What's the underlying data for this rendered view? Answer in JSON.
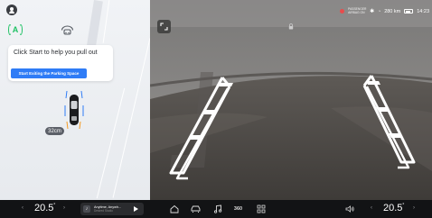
{
  "status_bar": {
    "airbag_text": "PASSENGER AIRBAG ON",
    "range": "280 km",
    "time": "14:23"
  },
  "parking_panel": {
    "hint_text": "Click Start to help you pull out",
    "start_button_label": "Start Exiting the Parking Space",
    "distance": "32cm"
  },
  "bottom_bar": {
    "left_temp": "20.5",
    "left_temp_unit": "°",
    "right_temp": "20.5",
    "right_temp_unit": "°",
    "media": {
      "title": "Anytime, Anywh...",
      "subtitle": "Desired Studio"
    },
    "dock_label_360": "360"
  },
  "colors": {
    "accent_green": "#20c265",
    "accent_blue": "#2f7cf6",
    "alert_red": "#e84c4c"
  }
}
